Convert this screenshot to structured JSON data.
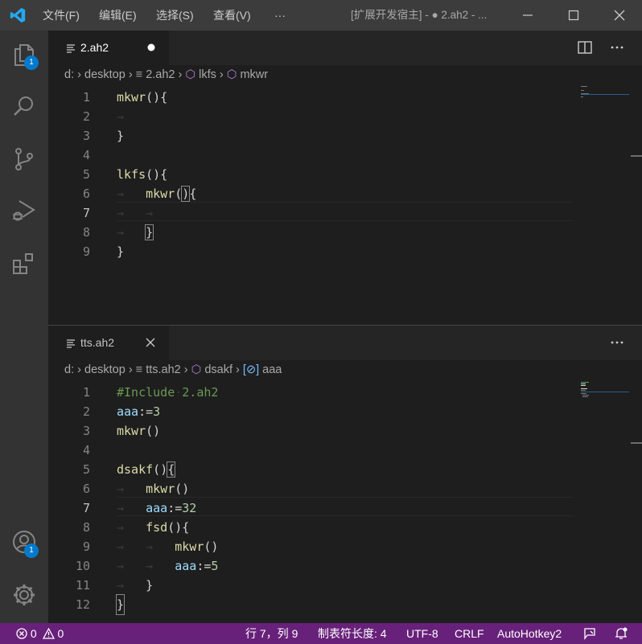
{
  "titlebar": {
    "menu": [
      "文件(F)",
      "编辑(E)",
      "选择(S)",
      "查看(V)"
    ],
    "more": "···",
    "title": "[扩展开发宿主] - ● 2.ah2 - ..."
  },
  "activity": {
    "explorer_badge": "1",
    "account_badge": "1"
  },
  "top_editor": {
    "tab_label": "2.ah2",
    "breadcrumb": {
      "drive": "d:",
      "folder": "desktop",
      "file": "2.ah2",
      "symbol1": "lkfs",
      "symbol2": "mkwr"
    },
    "line_numbers": [
      "1",
      "2",
      "3",
      "4",
      "5",
      "6",
      "7",
      "8",
      "9"
    ]
  },
  "bottom_editor": {
    "tab_label": "tts.ah2",
    "breadcrumb": {
      "drive": "d:",
      "folder": "desktop",
      "file": "tts.ah2",
      "symbol1": "dsakf",
      "symbol2": "aaa"
    },
    "line_numbers": [
      "1",
      "2",
      "3",
      "4",
      "5",
      "6",
      "7",
      "8",
      "9",
      "10",
      "11",
      "12"
    ]
  },
  "code_tokens": {
    "mkwr": "mkwr",
    "lkfs": "lkfs",
    "dsakf": "dsakf",
    "fsd": "fsd",
    "aaa": "aaa",
    "include": "#Include",
    "include_file": "2.ah2",
    "assign": ":=",
    "n3": "3",
    "n32": "32",
    "n5": "5",
    "parens": "()",
    "parens_brace": "(){",
    "open_paren": "(",
    "close_paren": ")",
    "open_brace": "{",
    "close_brace": "}",
    "tab_arrow": "→"
  },
  "statusbar": {
    "errors": "0",
    "warnings": "0",
    "cursor": "行 7，列 9",
    "tab_size": "制表符长度: 4",
    "encoding": "UTF-8",
    "eol": "CRLF",
    "language": "AutoHotkey2"
  },
  "colors": {
    "statusbar": "#68217a",
    "badge": "#007acc",
    "accent": "#0078d4"
  }
}
